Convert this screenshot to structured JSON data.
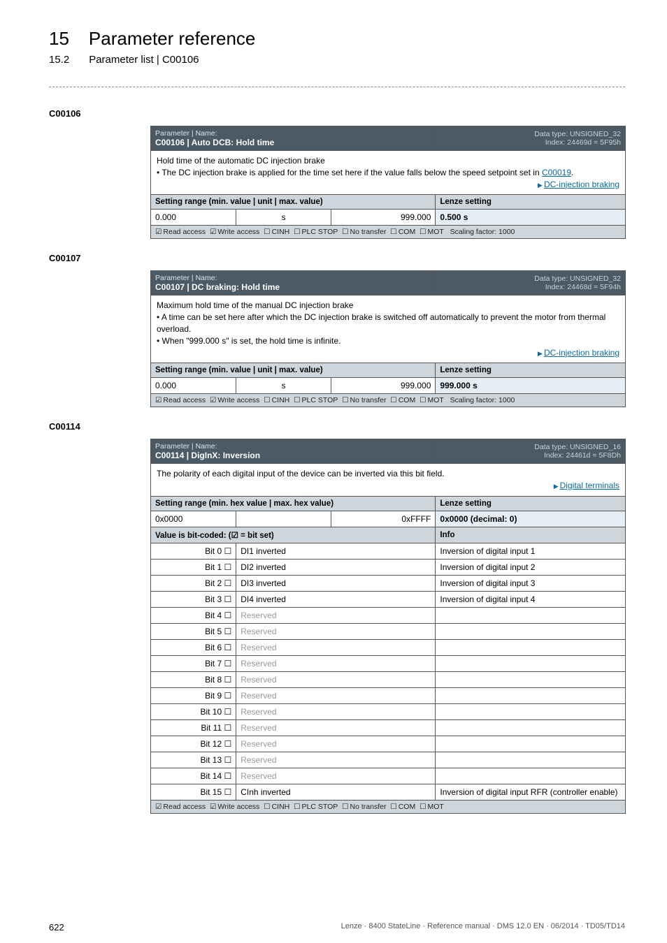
{
  "header": {
    "chapter_num": "15",
    "chapter_title": "Parameter reference",
    "section_num": "15.2",
    "section_title": "Parameter list | C00106"
  },
  "blocks": [
    {
      "code": "C00106",
      "name_label": "Parameter | Name:",
      "name": "C00106 | Auto DCB: Hold time",
      "dtype_line1": "Data type: UNSIGNED_32",
      "dtype_line2": "Index: 24469d = 5F95h",
      "desc_lines": [
        "Hold time of the automatic DC injection brake"
      ],
      "bullets": [
        [
          "• The DC injection brake is applied for the time set here if the value falls below the speed setpoint set in ",
          {
            "link": "C00019"
          },
          "."
        ]
      ],
      "trailing_link": "DC-injection braking",
      "setting_label": "Setting range (min. value | unit | max. value)",
      "lenze_label": "Lenze setting",
      "row": {
        "min": "0.000",
        "unit": "s",
        "max": "999.000",
        "lenze": "0.500 s"
      },
      "footer_parts": {
        "read": "Read access",
        "write": "Write access",
        "cinh": "CINH",
        "plc": "PLC STOP",
        "notransfer": "No transfer",
        "com": "COM",
        "mot": "MOT",
        "scaling": "Scaling factor: 1000"
      }
    },
    {
      "code": "C00107",
      "name_label": "Parameter | Name:",
      "name": "C00107 | DC braking: Hold time",
      "dtype_line1": "Data type: UNSIGNED_32",
      "dtype_line2": "Index: 24468d = 5F94h",
      "desc_lines": [
        "Maximum hold time of the manual DC injection brake"
      ],
      "bullets": [
        [
          "• A time can be set here after which the DC injection brake is switched off automatically to prevent the motor from thermal overload."
        ],
        [
          "• When \"999.000 s\" is set, the hold time is infinite."
        ]
      ],
      "trailing_link": "DC-injection braking",
      "setting_label": "Setting range (min. value | unit | max. value)",
      "lenze_label": "Lenze setting",
      "row": {
        "min": "0.000",
        "unit": "s",
        "max": "999.000",
        "lenze": "999.000 s"
      },
      "footer_parts": {
        "read": "Read access",
        "write": "Write access",
        "cinh": "CINH",
        "plc": "PLC STOP",
        "notransfer": "No transfer",
        "com": "COM",
        "mot": "MOT",
        "scaling": "Scaling factor: 1000"
      }
    }
  ],
  "block3": {
    "code": "C00114",
    "name_label": "Parameter | Name:",
    "name": "C00114 | DigInX: Inversion",
    "dtype_line1": "Data type: UNSIGNED_16",
    "dtype_line2": "Index: 24461d = 5F8Dh",
    "desc_lines": [
      "The polarity of each digital input of the device can be inverted via this bit field."
    ],
    "trailing_link": "Digital terminals",
    "setting_label": "Setting range (min. hex value | max. hex value)",
    "lenze_label": "Lenze setting",
    "rangerow": {
      "left": "0x0000",
      "mid": "",
      "right": "0xFFFF",
      "lenze": "0x0000  (decimal: 0)"
    },
    "bitcoded_label": "Value is bit-coded:  (☑ = bit set)",
    "info_label": "Info",
    "bits": [
      {
        "bit": "Bit 0 ☐",
        "name": "DI1 inverted",
        "info": "Inversion of digital input 1",
        "reserved": false
      },
      {
        "bit": "Bit 1 ☐",
        "name": "DI2 inverted",
        "info": "Inversion of digital input 2",
        "reserved": false
      },
      {
        "bit": "Bit 2 ☐",
        "name": "DI3 inverted",
        "info": "Inversion of digital input 3",
        "reserved": false
      },
      {
        "bit": "Bit 3 ☐",
        "name": "DI4 inverted",
        "info": "Inversion of digital input 4",
        "reserved": false
      },
      {
        "bit": "Bit 4 ☐",
        "name": "Reserved",
        "info": "",
        "reserved": true
      },
      {
        "bit": "Bit 5 ☐",
        "name": "Reserved",
        "info": "",
        "reserved": true
      },
      {
        "bit": "Bit 6 ☐",
        "name": "Reserved",
        "info": "",
        "reserved": true
      },
      {
        "bit": "Bit 7 ☐",
        "name": "Reserved",
        "info": "",
        "reserved": true
      },
      {
        "bit": "Bit 8 ☐",
        "name": "Reserved",
        "info": "",
        "reserved": true
      },
      {
        "bit": "Bit 9 ☐",
        "name": "Reserved",
        "info": "",
        "reserved": true
      },
      {
        "bit": "Bit 10 ☐",
        "name": "Reserved",
        "info": "",
        "reserved": true
      },
      {
        "bit": "Bit 11 ☐",
        "name": "Reserved",
        "info": "",
        "reserved": true
      },
      {
        "bit": "Bit 12 ☐",
        "name": "Reserved",
        "info": "",
        "reserved": true
      },
      {
        "bit": "Bit 13 ☐",
        "name": "Reserved",
        "info": "",
        "reserved": true
      },
      {
        "bit": "Bit 14 ☐",
        "name": "Reserved",
        "info": "",
        "reserved": true
      },
      {
        "bit": "Bit 15 ☐",
        "name": "CInh inverted",
        "info": "Inversion of digital input RFR (controller enable)",
        "reserved": false
      }
    ],
    "footer_parts": {
      "read": "Read access",
      "write": "Write access",
      "cinh": "CINH",
      "plc": "PLC STOP",
      "notransfer": "No transfer",
      "com": "COM",
      "mot": "MOT"
    }
  },
  "footer": {
    "page": "622",
    "doc": "Lenze · 8400 StateLine · Reference manual · DMS 12.0 EN · 06/2014 · TD05/TD14"
  }
}
